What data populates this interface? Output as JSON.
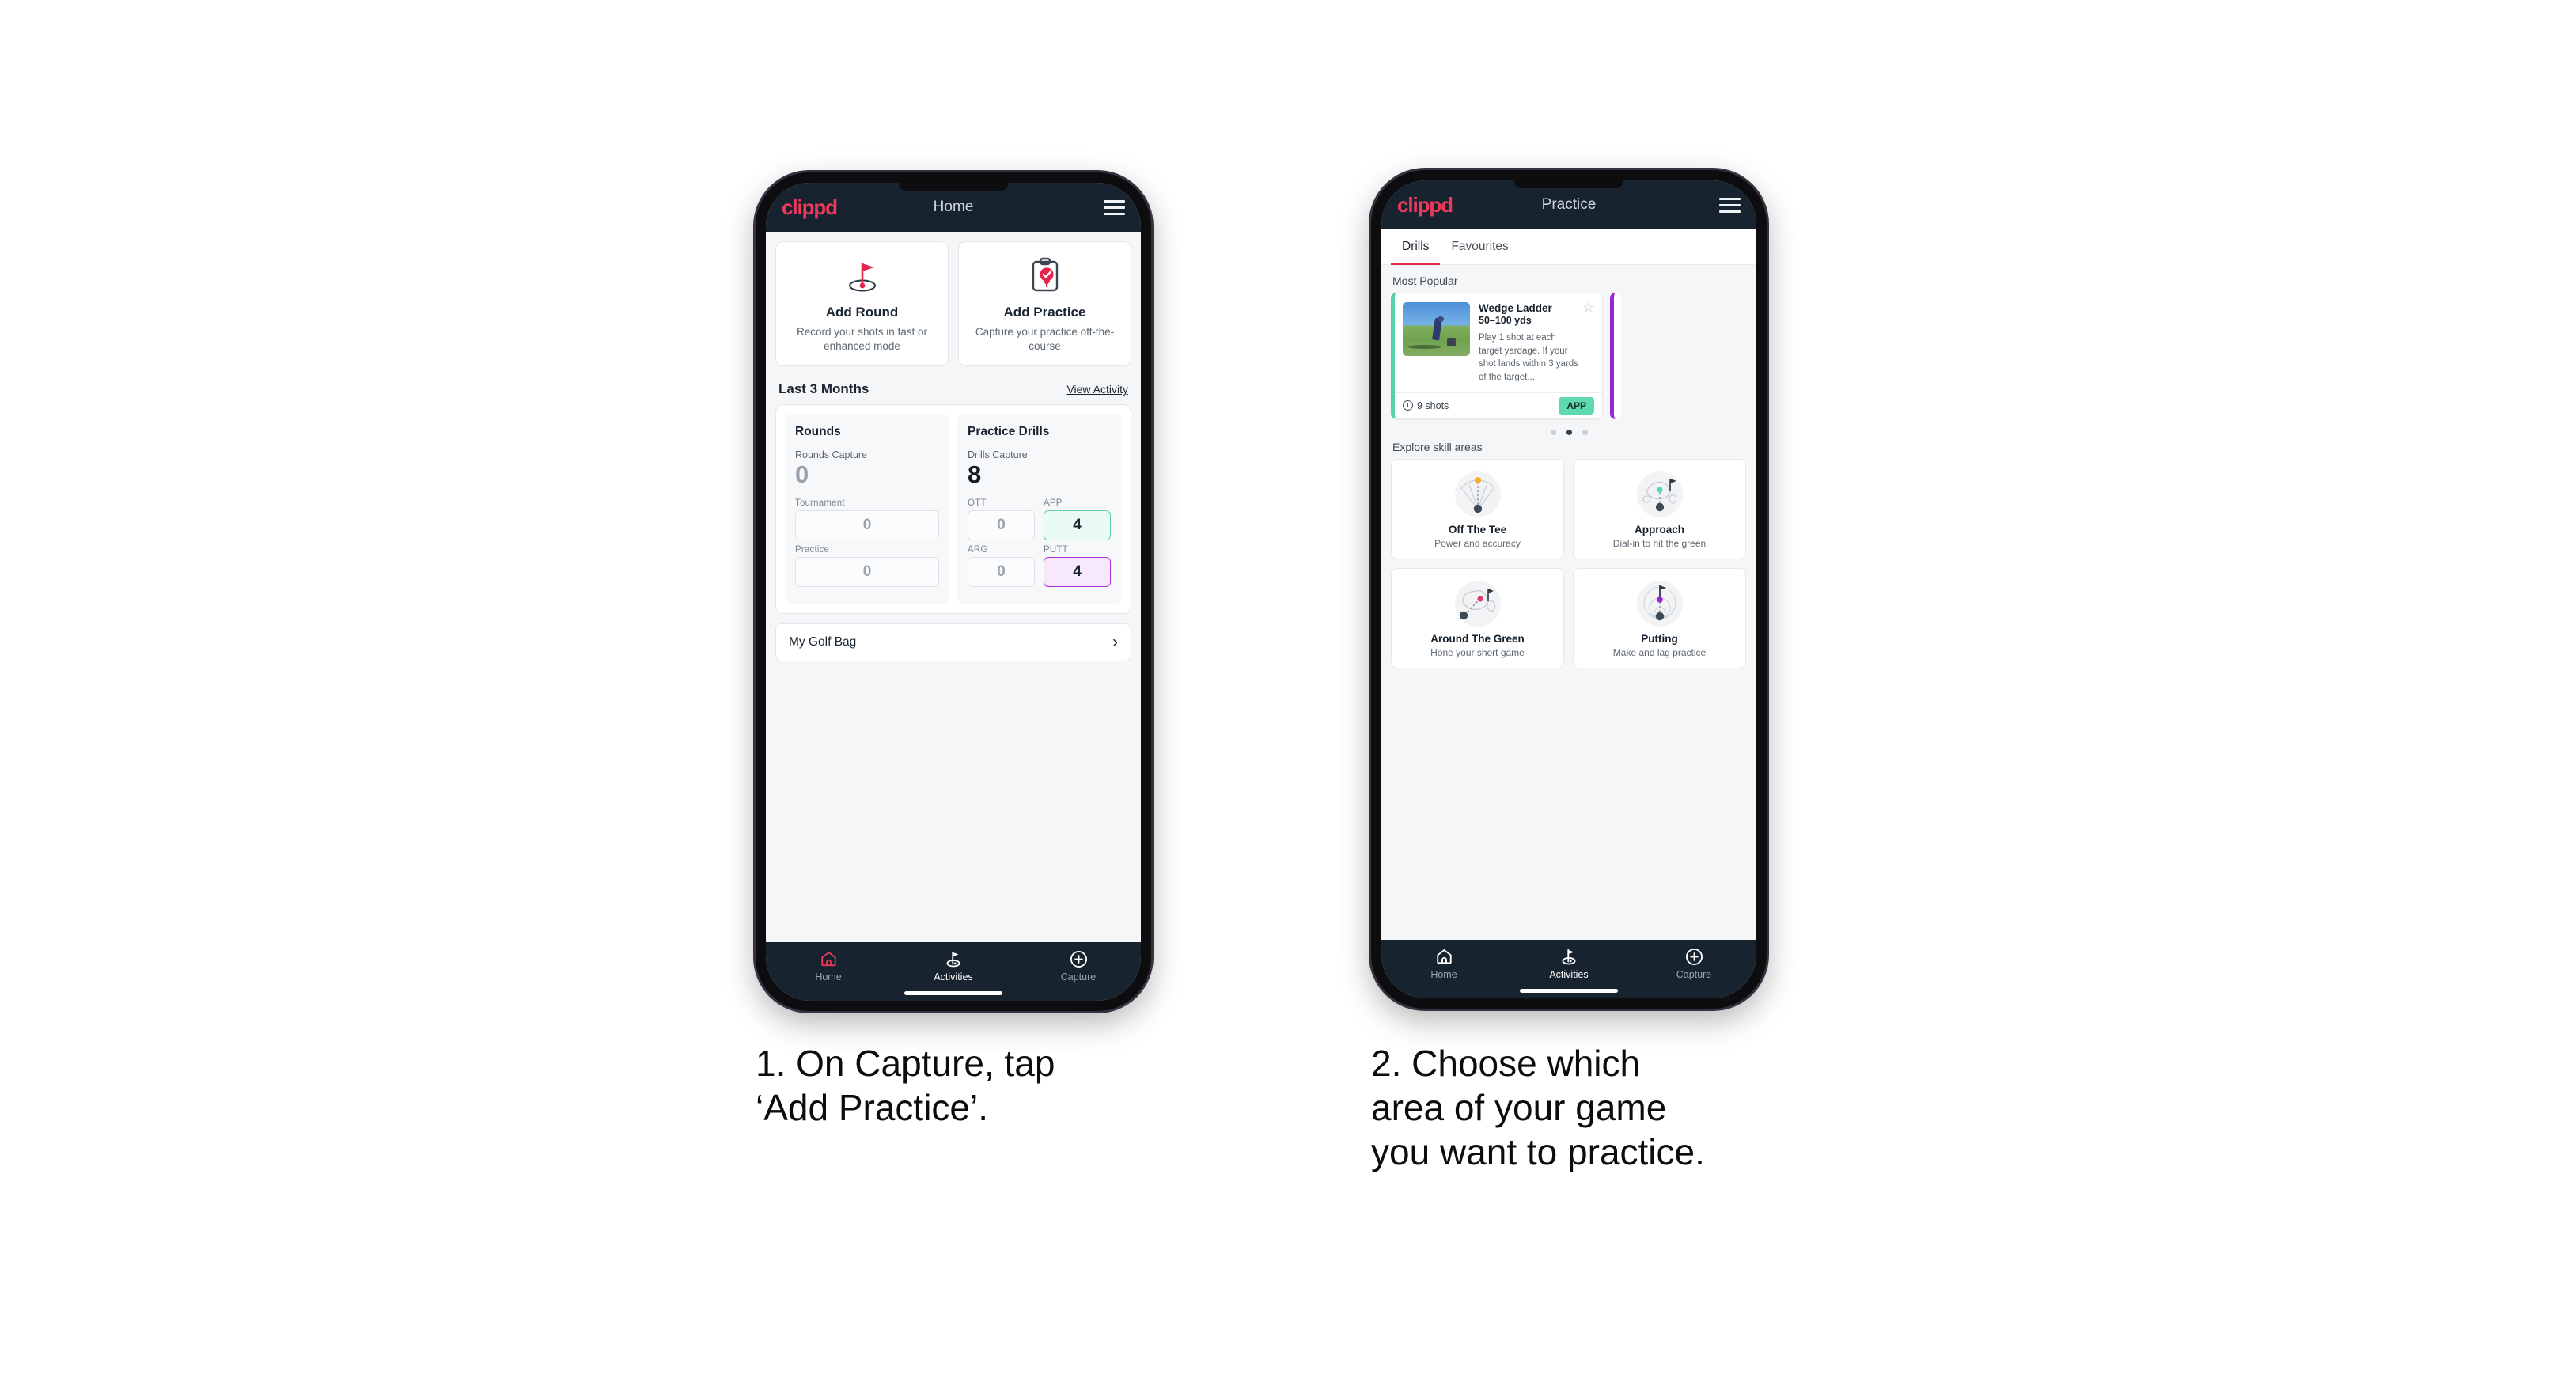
{
  "brand": "clippd",
  "colors": {
    "accent_pink": "#ec3a5d",
    "header_navy": "#17232e",
    "tab_underline": "#e4264f",
    "app_green": "#5fd9b0",
    "putt_purple": "#a830d6",
    "ott_yellow": "#f5b125",
    "arg_pink": "#e8376a"
  },
  "phone1": {
    "appbar": {
      "title": "Home",
      "menu_icon": "hamburger-icon"
    },
    "quick_actions": [
      {
        "icon": "golf-flag-hole-icon",
        "title": "Add Round",
        "subtitle": "Record your shots in fast or enhanced mode"
      },
      {
        "icon": "clipboard-check-tee-icon",
        "title": "Add Practice",
        "subtitle": "Capture your practice off-the-course"
      }
    ],
    "section": {
      "title": "Last 3 Months",
      "link": "View Activity"
    },
    "stats": {
      "rounds": {
        "title": "Rounds",
        "capture_label": "Rounds Capture",
        "capture_value": "0",
        "items": [
          {
            "label": "Tournament",
            "value": "0",
            "state": "empty"
          },
          {
            "label": "Practice",
            "value": "0",
            "state": "empty"
          }
        ]
      },
      "drills": {
        "title": "Practice Drills",
        "capture_label": "Drills Capture",
        "capture_value": "8",
        "items": [
          {
            "label": "OTT",
            "value": "0",
            "state": "empty"
          },
          {
            "label": "APP",
            "value": "4",
            "state": "green"
          },
          {
            "label": "ARG",
            "value": "0",
            "state": "empty"
          },
          {
            "label": "PUTT",
            "value": "4",
            "state": "purple"
          }
        ]
      }
    },
    "golf_bag": {
      "label": "My Golf Bag",
      "chevron": "chevron-right-icon"
    },
    "bottom_nav": [
      {
        "label": "Home",
        "icon": "home-icon",
        "active": "true"
      },
      {
        "label": "Activities",
        "icon": "golf-flag-icon",
        "active": "false"
      },
      {
        "label": "Capture",
        "icon": "plus-circle-icon",
        "active": "false"
      }
    ]
  },
  "phone2": {
    "appbar": {
      "title": "Practice",
      "menu_icon": "hamburger-icon"
    },
    "tabs": [
      {
        "label": "Drills",
        "active": "true"
      },
      {
        "label": "Favourites",
        "active": "false"
      }
    ],
    "most_popular_label": "Most Popular",
    "drill": {
      "name": "Wedge Ladder",
      "yardage": "50–100 yds",
      "description": "Play 1 shot at each target yardage. If your shot lands within 3 yards of the target...",
      "shots": "9 shots",
      "tag": "APP",
      "star_icon": "star-outline-icon",
      "clock_icon": "clock-icon",
      "thumbnail": "golfer-chipping-photo"
    },
    "carousel_dots": {
      "count": 3,
      "active_index": 1
    },
    "explore_label": "Explore skill areas",
    "skill_areas": [
      {
        "title": "Off The Tee",
        "subtitle": "Power and accuracy",
        "icon": "tee-shot-dispersion-icon"
      },
      {
        "title": "Approach",
        "subtitle": "Dial-in to hit the green",
        "icon": "approach-green-icon"
      },
      {
        "title": "Around The Green",
        "subtitle": "Hone your short game",
        "icon": "chip-green-icon"
      },
      {
        "title": "Putting",
        "subtitle": "Make and lag practice",
        "icon": "putting-rings-icon"
      }
    ],
    "bottom_nav": [
      {
        "label": "Home",
        "icon": "home-icon",
        "active": "false"
      },
      {
        "label": "Activities",
        "icon": "golf-flag-icon",
        "active": "true"
      },
      {
        "label": "Capture",
        "icon": "plus-circle-icon",
        "active": "false"
      }
    ]
  },
  "captions": {
    "step1": "1. On Capture, tap\n‘Add Practice’.",
    "step2": "2. Choose which\narea of your game\nyou want to practice."
  }
}
